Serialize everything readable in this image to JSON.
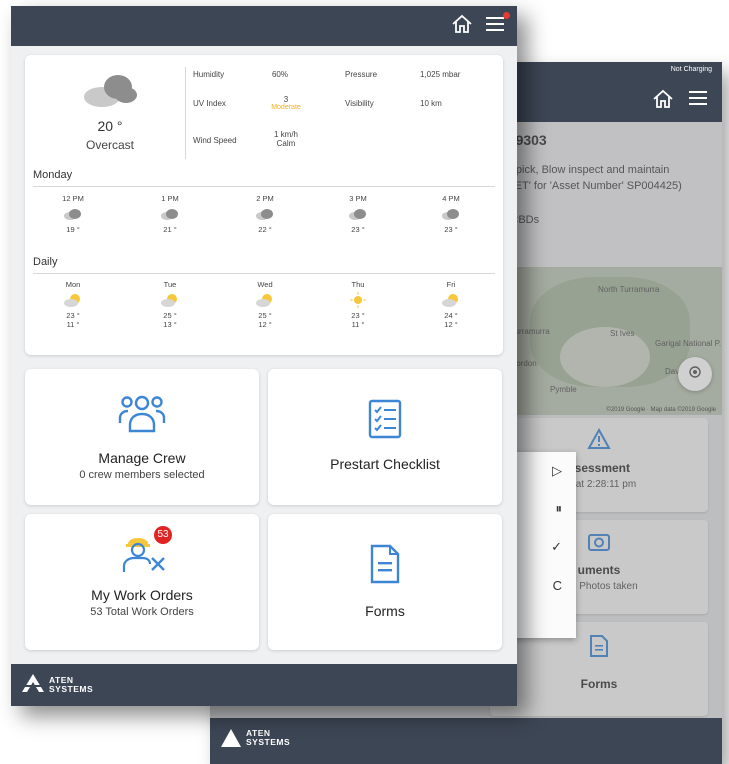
{
  "colors": {
    "nav": "#3d4655",
    "accent": "#3d86d6",
    "badge": "#e02424",
    "moderate": "#f2b01e"
  },
  "front": {
    "weather": {
      "temperature": "20 °",
      "condition": "Overcast",
      "stats": {
        "humidity_label": "Humidity",
        "humidity_value": "60%",
        "pressure_label": "Pressure",
        "pressure_value": "1,025 mbar",
        "uv_label": "UV Index",
        "uv_value": "3",
        "uv_level": "Moderate",
        "visibility_label": "Visibility",
        "visibility_value": "10 km",
        "wind_label": "Wind Speed",
        "wind_value": "1 km/h",
        "wind_desc": "Calm"
      },
      "hourly_label": "Monday",
      "hourly": [
        {
          "time": "12 PM",
          "temp": "19 °",
          "icon": "cloud-icon"
        },
        {
          "time": "1 PM",
          "temp": "21 °",
          "icon": "cloud-icon"
        },
        {
          "time": "2 PM",
          "temp": "22 °",
          "icon": "cloud-icon"
        },
        {
          "time": "3 PM",
          "temp": "23 °",
          "icon": "cloud-icon"
        },
        {
          "time": "4 PM",
          "temp": "23 °",
          "icon": "cloud-icon"
        }
      ],
      "daily_label": "Daily",
      "daily": [
        {
          "day": "Mon",
          "high": "23 °",
          "low": "11 °",
          "icon": "partly-cloudy-icon"
        },
        {
          "day": "Tue",
          "high": "25 °",
          "low": "13 °",
          "icon": "partly-cloudy-icon"
        },
        {
          "day": "Wed",
          "high": "25 °",
          "low": "12 °",
          "icon": "partly-cloudy-icon"
        },
        {
          "day": "Thu",
          "high": "23 °",
          "low": "11 °",
          "icon": "sun-icon"
        },
        {
          "day": "Fri",
          "high": "24 °",
          "low": "12 °",
          "icon": "partly-cloudy-icon"
        }
      ]
    },
    "tiles": {
      "manage_crew": {
        "title": "Manage Crew",
        "sub": "0 crew members selected"
      },
      "prestart": {
        "title": "Prestart Checklist"
      },
      "work_orders": {
        "title": "My Work Orders",
        "sub": "53 Total Work Orders",
        "badge": "53"
      },
      "forms": {
        "title": "Forms"
      }
    },
    "footer": {
      "logo_line1": "ATEN",
      "logo_line2": "SYSTEMS"
    }
  },
  "back": {
    "status": "Not Charging",
    "work_order_number": "049303",
    "description_line1": "ter pick, Blow inspect and maintain",
    "description_line2": "SSET' for 'Asset Number' SP004425)",
    "subtitle": "& CBDs",
    "map_labels": [
      "North Turramurra",
      "Turramurra",
      "St Ives",
      "Gordon",
      "Garigal National P.",
      "Davidson",
      "Pymble"
    ],
    "map_credit": "©2019 Google · Map data ©2019 Google",
    "menu": [
      "▷",
      "⏸",
      "✓",
      "C"
    ],
    "cards": [
      {
        "title": "ssessment",
        "sub": "ed at 2:28:11 pm"
      },
      {
        "title": "uments",
        "sub": "s, 0 Photos taken"
      },
      {
        "title": "Forms",
        "sub": ""
      }
    ],
    "footer": {
      "logo_line1": "ATEN",
      "logo_line2": "SYSTEMS"
    }
  }
}
